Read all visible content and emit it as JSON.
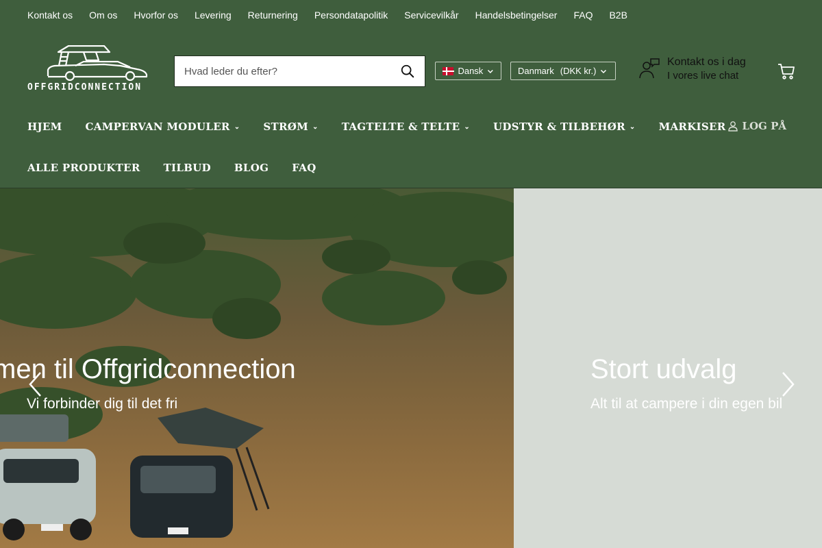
{
  "utility_nav": [
    "Kontakt os",
    "Om os",
    "Hvorfor os",
    "Levering",
    "Returnering",
    "Persondatapolitik",
    "Servicevilkår",
    "Handelsbetingelser",
    "FAQ",
    "B2B"
  ],
  "logo": {
    "text": "OFFGRIDCONNECTION"
  },
  "search": {
    "placeholder": "Hvad leder du efter?",
    "value": ""
  },
  "language": {
    "label": "Dansk",
    "flag": "denmark-flag-icon"
  },
  "currency": {
    "country": "Danmark",
    "currency": "(DKK kr.)"
  },
  "contact": {
    "title": "Kontakt os i dag",
    "subtitle": "I vores live chat",
    "icon": "support-chat-icon"
  },
  "cart": {
    "icon": "cart-icon"
  },
  "main_nav": {
    "row1": [
      {
        "label": "HJEM",
        "dropdown": false
      },
      {
        "label": "CAMPERVAN MODULER",
        "dropdown": true
      },
      {
        "label": "STRØM",
        "dropdown": true
      },
      {
        "label": "TAGTELTE & TELTE",
        "dropdown": true
      },
      {
        "label": "UDSTYR & TILBEHØR",
        "dropdown": true
      },
      {
        "label": "MARKISER",
        "dropdown": false
      }
    ],
    "row2": [
      {
        "label": "ALLE PRODUKTER",
        "dropdown": false
      },
      {
        "label": "TILBUD",
        "dropdown": false
      },
      {
        "label": "BLOG",
        "dropdown": false
      },
      {
        "label": "FAQ",
        "dropdown": false
      }
    ],
    "login": "LOG PÅ"
  },
  "slides": [
    {
      "title": "men til Offgridconnection",
      "subtitle": "Vi forbinder dig til det fri"
    },
    {
      "title": "Stort udvalg",
      "subtitle": "Alt til at campere i din egen bil"
    }
  ],
  "colors": {
    "brand_green": "#3f5e3d",
    "slide_bg": "#d6dbd5"
  }
}
